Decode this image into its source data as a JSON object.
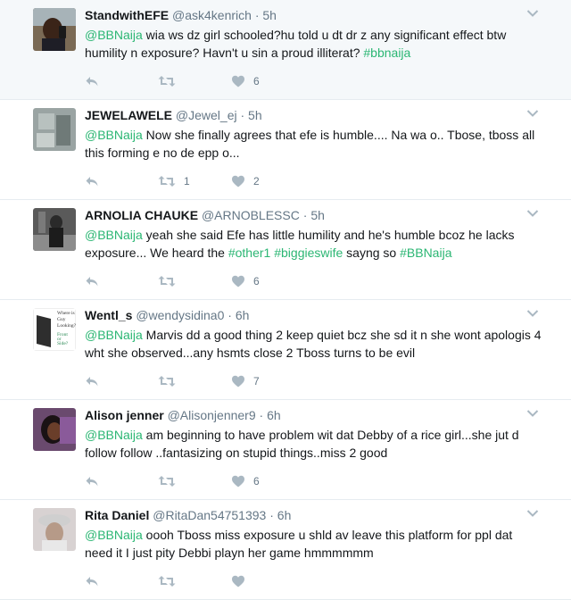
{
  "tweets": [
    {
      "name": "StandwithEFE",
      "handle": "@ask4kenrich",
      "time": "5h",
      "parts": [
        {
          "t": "@BBNaija",
          "k": "mention"
        },
        {
          "t": " wia ws dz girl schooled?hu told u dt dr z any significant effect btw humility n exposure? Havn't u sin a proud illiterat? ",
          "k": "text"
        },
        {
          "t": "#bbnaija",
          "k": "tag"
        }
      ],
      "retweets": "",
      "likes": "6"
    },
    {
      "name": "JEWELAWELE",
      "handle": "@Jewel_ej",
      "time": "5h",
      "parts": [
        {
          "t": "@BBNaija",
          "k": "mention"
        },
        {
          "t": " Now she finally agrees that efe is humble.... Na wa o.. Tbose, tboss all this forming e no de epp o...",
          "k": "text"
        }
      ],
      "retweets": "1",
      "likes": "2"
    },
    {
      "name": "ARNOLIA CHAUKE",
      "handle": "@ARNOBLESSC",
      "time": "5h",
      "parts": [
        {
          "t": "@BBNaija",
          "k": "mention"
        },
        {
          "t": " yeah she said Efe has little humility and he's humble bcoz he lacks exposure... We heard the ",
          "k": "text"
        },
        {
          "t": "#other1",
          "k": "tag"
        },
        {
          "t": " ",
          "k": "text"
        },
        {
          "t": "#biggieswife",
          "k": "tag"
        },
        {
          "t": " sayng so ",
          "k": "text"
        },
        {
          "t": "#BBNaija",
          "k": "tag"
        }
      ],
      "retweets": "",
      "likes": "6"
    },
    {
      "name": "Wentl_s",
      "handle": "@wendysidina0",
      "time": "6h",
      "parts": [
        {
          "t": "@BBNaija",
          "k": "mention"
        },
        {
          "t": " Marvis dd a good thing 2 keep quiet bcz she sd it n she wont apologis 4 wht she observed...any hsmts close 2 Tboss turns to be evil",
          "k": "text"
        }
      ],
      "retweets": "",
      "likes": "7"
    },
    {
      "name": "Alison jenner",
      "handle": "@Alisonjenner9",
      "time": "6h",
      "parts": [
        {
          "t": "@BBNaija",
          "k": "mention"
        },
        {
          "t": "  am beginning to have problem wit dat Debby of a rice girl...she jut d follow follow ..fantasizing on stupid things..miss 2 good",
          "k": "text"
        }
      ],
      "retweets": "",
      "likes": "6"
    },
    {
      "name": "Rita Daniel",
      "handle": "@RitaDan54751393",
      "time": "6h",
      "parts": [
        {
          "t": "@BBNaija",
          "k": "mention"
        },
        {
          "t": " oooh Tboss miss exposure u shld av leave this platform for ppl dat need it I just pity Debbi playn her game hmmmmmm",
          "k": "text"
        }
      ],
      "retweets": "",
      "likes": ""
    }
  ],
  "avatars": [
    "avatar-photo-man-phone",
    "avatar-photo-wall",
    "avatar-photo-person",
    "avatar-book-cover",
    "avatar-photo-woman",
    "avatar-photo-woman-hat"
  ],
  "avatar_book_text": [
    "Where is the",
    "Guy",
    "Looking?",
    "Front",
    "or",
    "Side?"
  ],
  "colors": {
    "link": "#2bb673",
    "meta": "#657786",
    "icon": "#aab8c2",
    "divider": "#e6ecf0",
    "highlight_bg": "#f5f8fa"
  }
}
